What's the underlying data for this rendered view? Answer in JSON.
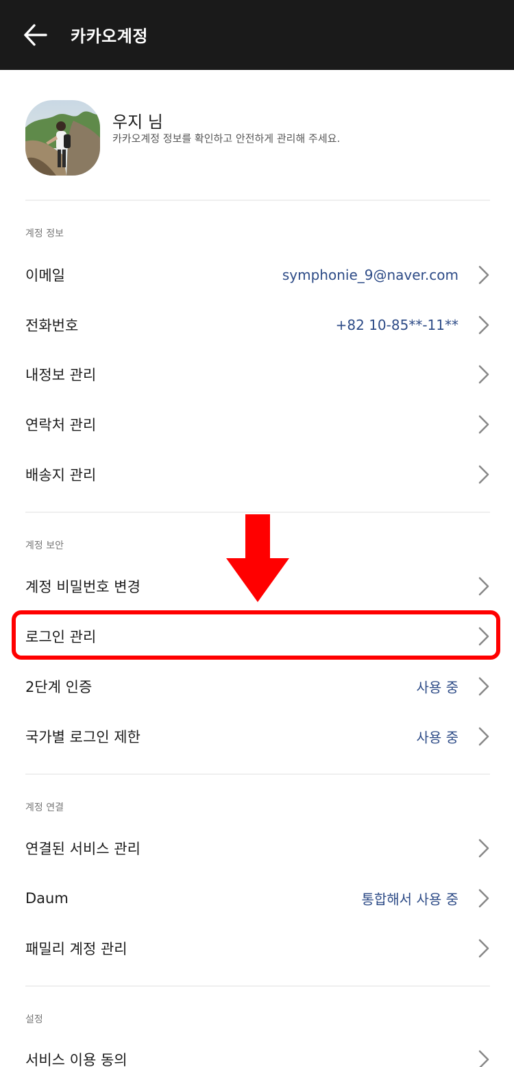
{
  "header": {
    "title": "카카오계정"
  },
  "profile": {
    "name": "우지 님",
    "description": "카카오계정 정보를 확인하고 안전하게 관리해 주세요."
  },
  "sections": {
    "account_info": {
      "title": "계정 정보",
      "items": [
        {
          "label": "이메일",
          "value": "symphonie_9@naver.com"
        },
        {
          "label": "전화번호",
          "value": "+82 10-85**-11**"
        },
        {
          "label": "내정보 관리"
        },
        {
          "label": "연락처 관리"
        },
        {
          "label": "배송지 관리"
        }
      ]
    },
    "account_security": {
      "title": "계정 보안",
      "items": [
        {
          "label": "계정 비밀번호 변경"
        },
        {
          "label": "로그인 관리"
        },
        {
          "label": "2단계 인증",
          "value": "사용 중"
        },
        {
          "label": "국가별 로그인 제한",
          "value": "사용 중"
        }
      ]
    },
    "account_link": {
      "title": "계정 연결",
      "items": [
        {
          "label": "연결된 서비스 관리"
        },
        {
          "label": "Daum",
          "value": "통합해서 사용 중"
        },
        {
          "label": "패밀리 계정 관리"
        }
      ]
    },
    "settings": {
      "title": "설정",
      "items": [
        {
          "label": "서비스 이용 동의"
        }
      ]
    }
  },
  "colors": {
    "header_bg": "#1a1a1a",
    "value_text": "#2c4a86",
    "highlight": "#ff0000",
    "chevron": "#888888"
  },
  "icons": {
    "back": "arrow-left-icon",
    "chevron": "chevron-right-icon",
    "annotation": "down-arrow-annotation"
  }
}
